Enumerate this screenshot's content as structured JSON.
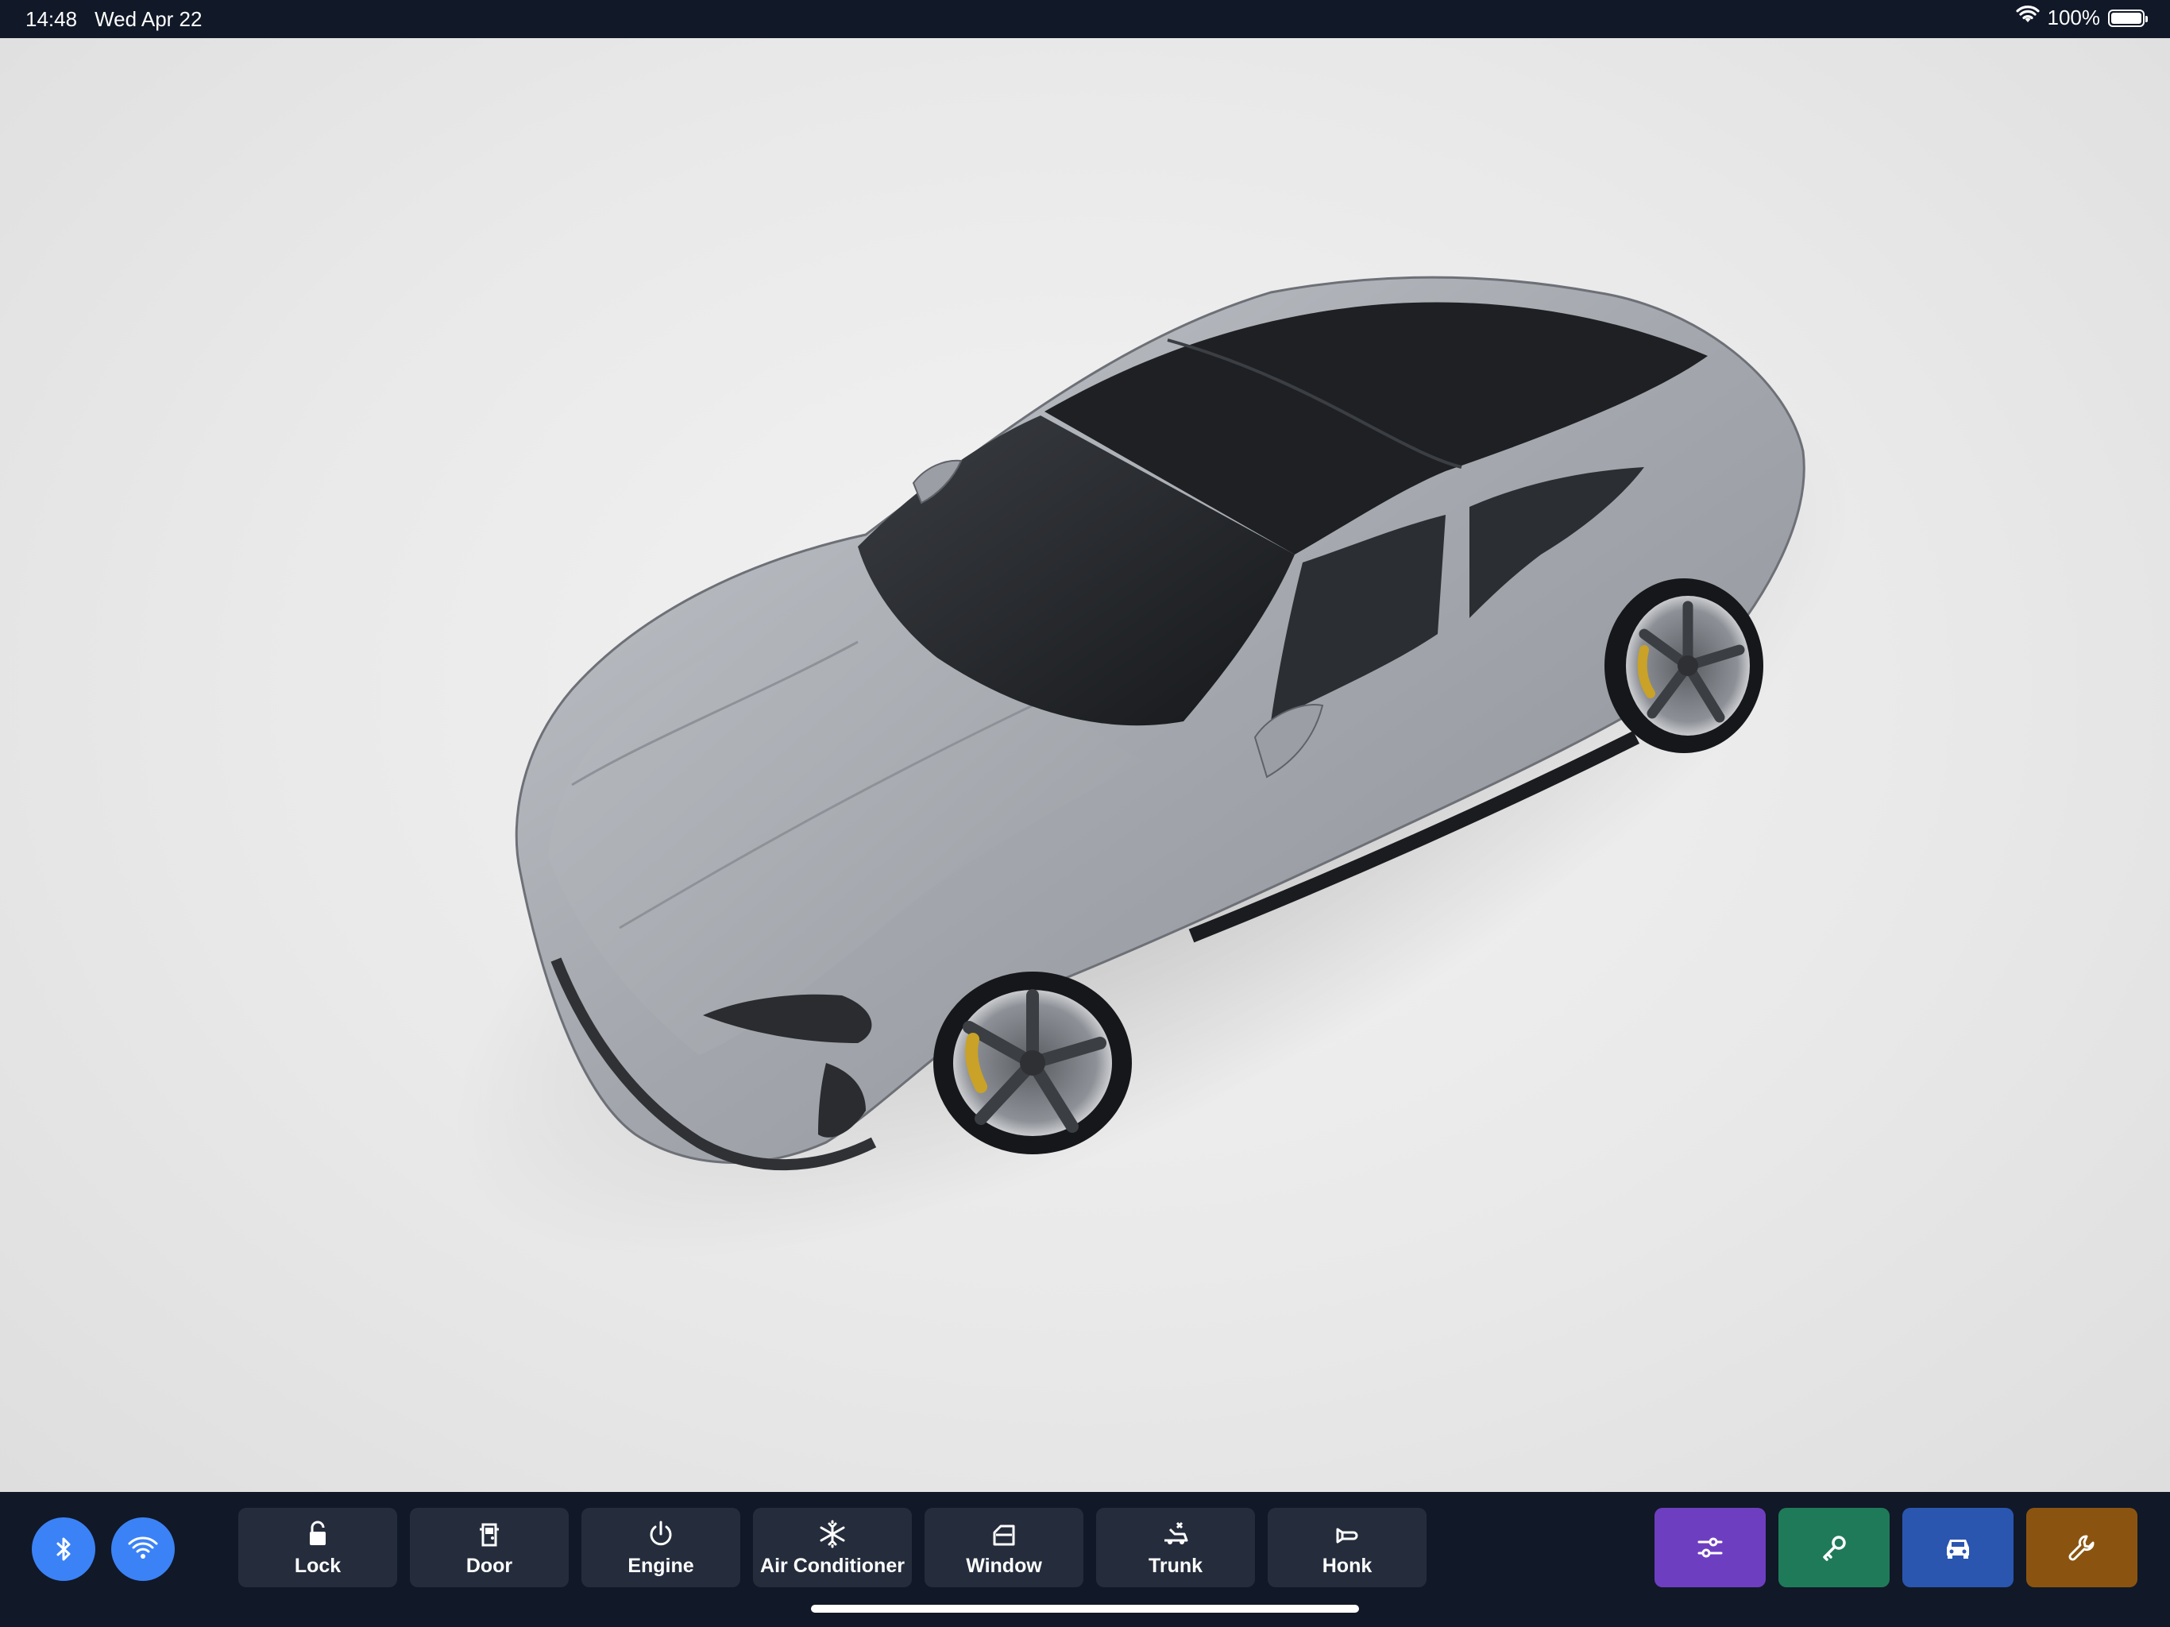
{
  "status_bar": {
    "time": "14:48",
    "date": "Wed Apr 22",
    "battery": "100%",
    "battery_level": 1.0
  },
  "viewer": {
    "subject": "car-3d-model",
    "body_color": "#a7aab0"
  },
  "connectivity": {
    "bluetooth_icon": "bluetooth-icon",
    "wifi_icon": "wifi-icon",
    "accent": "#3b82f6"
  },
  "actions": [
    {
      "label": "Lock",
      "icon": "lock-icon"
    },
    {
      "label": "Door",
      "icon": "door-icon"
    },
    {
      "label": "Engine",
      "icon": "power-icon"
    },
    {
      "label": "Air Conditioner",
      "icon": "snowflake-icon"
    },
    {
      "label": "Window",
      "icon": "window-icon"
    },
    {
      "label": "Trunk",
      "icon": "trunk-icon"
    },
    {
      "label": "Honk",
      "icon": "horn-icon"
    }
  ],
  "tools": [
    {
      "icon": "sliders-icon",
      "color": "#6d3fc0"
    },
    {
      "icon": "key-icon",
      "color": "#1f7a5a"
    },
    {
      "icon": "car-icon",
      "color": "#2a56b0"
    },
    {
      "icon": "wrench-icon",
      "color": "#8a5410"
    }
  ]
}
